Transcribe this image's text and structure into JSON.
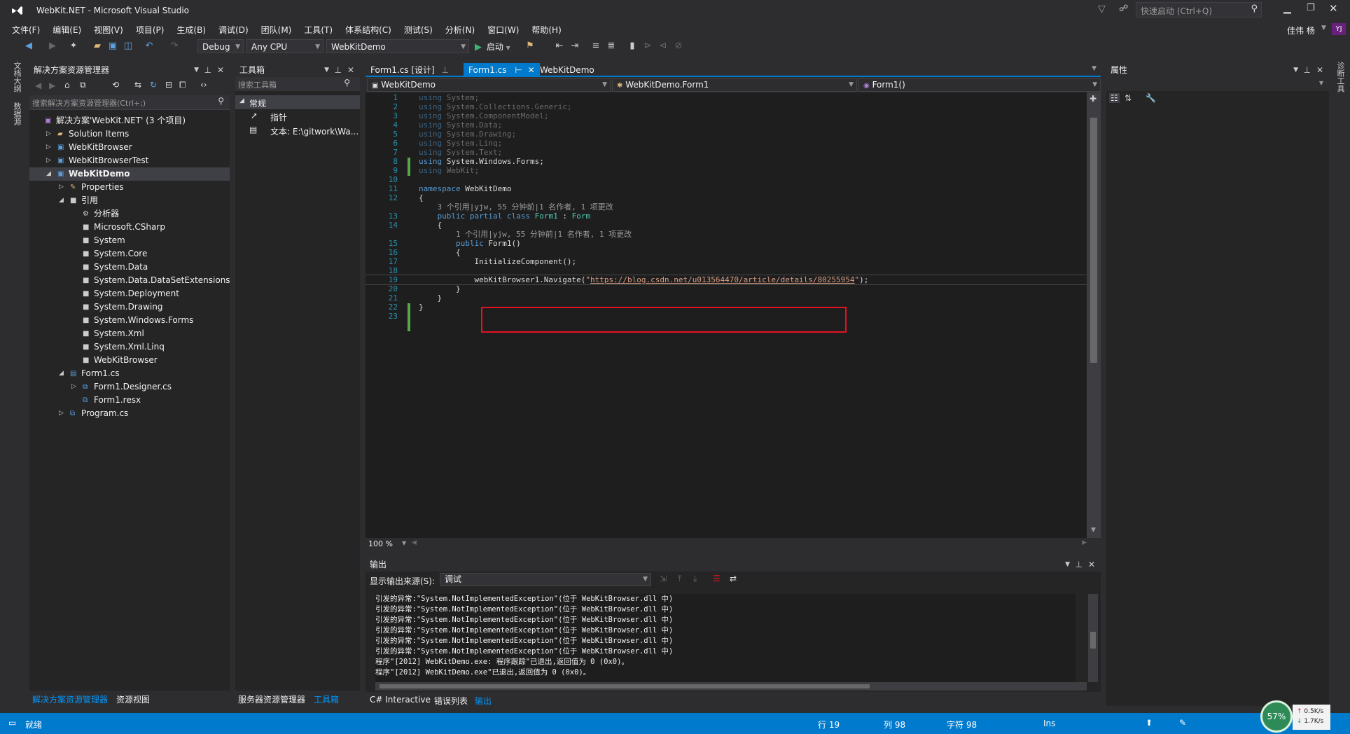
{
  "window": {
    "title": "WebKit.NET - Microsoft Visual Studio",
    "quick_launch": "快速启动 (Ctrl+Q)",
    "user": "佳伟 杨",
    "user_badge": "YJ"
  },
  "menu": [
    "文件(F)",
    "编辑(E)",
    "视图(V)",
    "项目(P)",
    "生成(B)",
    "调试(D)",
    "团队(M)",
    "工具(T)",
    "体系结构(C)",
    "测试(S)",
    "分析(N)",
    "窗口(W)",
    "帮助(H)"
  ],
  "toolbar": {
    "config": "Debug",
    "platform": "Any CPU",
    "project": "WebKitDemo",
    "start_label": "启动"
  },
  "left_strip": [
    "文档大纲",
    "数据源"
  ],
  "right_strip": [
    "诊断工具"
  ],
  "solution_explorer": {
    "title": "解决方案资源管理器",
    "search_placeholder": "搜索解决方案资源管理器(Ctrl+;)",
    "items": [
      {
        "label": "解决方案'WebKit.NET' (3 个项目)",
        "level": 0,
        "expander": "",
        "icon": "solution-icon",
        "bold": false,
        "selected": false
      },
      {
        "label": "Solution Items",
        "level": 1,
        "expander": "▷",
        "icon": "folder-icon",
        "bold": false,
        "selected": false
      },
      {
        "label": "WebKitBrowser",
        "level": 1,
        "expander": "▷",
        "icon": "csproj-icon",
        "bold": false,
        "selected": false
      },
      {
        "label": "WebKitBrowserTest",
        "level": 1,
        "expander": "▷",
        "icon": "csproj-icon",
        "bold": false,
        "selected": false
      },
      {
        "label": "WebKitDemo",
        "level": 1,
        "expander": "◢",
        "icon": "csproj-icon",
        "bold": true,
        "selected": true
      },
      {
        "label": "Properties",
        "level": 2,
        "expander": "▷",
        "icon": "wrench-icon",
        "bold": false,
        "selected": false
      },
      {
        "label": "引用",
        "level": 2,
        "expander": "◢",
        "icon": "references-icon",
        "bold": false,
        "selected": false
      },
      {
        "label": "分析器",
        "level": 3,
        "expander": "",
        "icon": "analyzer-icon",
        "bold": false,
        "selected": false
      },
      {
        "label": "Microsoft.CSharp",
        "level": 3,
        "expander": "",
        "icon": "reference-icon",
        "bold": false,
        "selected": false
      },
      {
        "label": "System",
        "level": 3,
        "expander": "",
        "icon": "reference-icon",
        "bold": false,
        "selected": false
      },
      {
        "label": "System.Core",
        "level": 3,
        "expander": "",
        "icon": "reference-icon",
        "bold": false,
        "selected": false
      },
      {
        "label": "System.Data",
        "level": 3,
        "expander": "",
        "icon": "reference-icon",
        "bold": false,
        "selected": false
      },
      {
        "label": "System.Data.DataSetExtensions",
        "level": 3,
        "expander": "",
        "icon": "reference-icon",
        "bold": false,
        "selected": false
      },
      {
        "label": "System.Deployment",
        "level": 3,
        "expander": "",
        "icon": "reference-icon",
        "bold": false,
        "selected": false
      },
      {
        "label": "System.Drawing",
        "level": 3,
        "expander": "",
        "icon": "reference-icon",
        "bold": false,
        "selected": false
      },
      {
        "label": "System.Windows.Forms",
        "level": 3,
        "expander": "",
        "icon": "reference-icon",
        "bold": false,
        "selected": false
      },
      {
        "label": "System.Xml",
        "level": 3,
        "expander": "",
        "icon": "reference-icon",
        "bold": false,
        "selected": false
      },
      {
        "label": "System.Xml.Linq",
        "level": 3,
        "expander": "",
        "icon": "reference-icon",
        "bold": false,
        "selected": false
      },
      {
        "label": "WebKitBrowser",
        "level": 3,
        "expander": "",
        "icon": "reference-icon",
        "bold": false,
        "selected": false
      },
      {
        "label": "Form1.cs",
        "level": 2,
        "expander": "◢",
        "icon": "form-icon",
        "bold": false,
        "selected": false
      },
      {
        "label": "Form1.Designer.cs",
        "level": 3,
        "expander": "▷",
        "icon": "cs-file-icon",
        "bold": false,
        "selected": false
      },
      {
        "label": "Form1.resx",
        "level": 3,
        "expander": "",
        "icon": "resx-icon",
        "bold": false,
        "selected": false
      },
      {
        "label": "Program.cs",
        "level": 2,
        "expander": "▷",
        "icon": "cs-file-icon",
        "bold": false,
        "selected": false
      }
    ],
    "bottom_tabs": [
      "解决方案资源管理器",
      "资源视图"
    ]
  },
  "toolbox": {
    "title": "工具箱",
    "search_placeholder": "搜索工具箱",
    "group": "常规",
    "items": [
      "指针",
      "文本: E:\\gitwork\\Wa..."
    ],
    "bottom_tabs": [
      "服务器资源管理器",
      "工具箱"
    ]
  },
  "editor": {
    "tabs": [
      {
        "label": "Form1.cs [设计]",
        "active": false
      },
      {
        "label": "Form1.cs",
        "active": true
      },
      {
        "label": "WebKitDemo",
        "active": false
      }
    ],
    "nav": {
      "project": "WebKitDemo",
      "type": "WebKitDemo.Form1",
      "member": "Form1()"
    },
    "zoom": "100 %",
    "lines": [
      {
        "n": "1",
        "text": "using System;",
        "kind": "using-dim"
      },
      {
        "n": "2",
        "text": "using System.Collections.Generic;",
        "kind": "using-dim"
      },
      {
        "n": "3",
        "text": "using System.ComponentModel;",
        "kind": "using-dim"
      },
      {
        "n": "4",
        "text": "using System.Data;",
        "kind": "using-dim"
      },
      {
        "n": "5",
        "text": "using System.Drawing;",
        "kind": "using-dim"
      },
      {
        "n": "6",
        "text": "using System.Linq;",
        "kind": "using-dim"
      },
      {
        "n": "7",
        "text": "using System.Text;",
        "kind": "using-dim"
      },
      {
        "n": "8",
        "text": "using System.Windows.Forms;",
        "kind": "using"
      },
      {
        "n": "9",
        "text": "using WebKit;",
        "kind": "using-dim"
      },
      {
        "n": "10",
        "text": "",
        "kind": "plain"
      },
      {
        "n": "11",
        "text": "namespace WebKitDemo",
        "kind": "namespace"
      },
      {
        "n": "12",
        "text": "{",
        "kind": "plain"
      },
      {
        "n": "",
        "text": "    3 个引用|yjw, 55 分钟前|1 名作者, 1 项更改",
        "kind": "lens"
      },
      {
        "n": "13",
        "text": "    public partial class Form1 : Form",
        "kind": "class"
      },
      {
        "n": "14",
        "text": "    {",
        "kind": "plain"
      },
      {
        "n": "",
        "text": "        1 个引用|yjw, 55 分钟前|1 名作者, 1 项更改",
        "kind": "lens"
      },
      {
        "n": "15",
        "text": "        public Form1()",
        "kind": "ctor"
      },
      {
        "n": "16",
        "text": "        {",
        "kind": "plain"
      },
      {
        "n": "17",
        "text": "            InitializeComponent();",
        "kind": "plain"
      },
      {
        "n": "18",
        "text": "",
        "kind": "plain"
      },
      {
        "n": "19",
        "text": "            webKitBrowser1.Navigate(\"https://blog.csdn.net/u013564470/article/details/80255954\");",
        "kind": "navigate"
      },
      {
        "n": "20",
        "text": "        }",
        "kind": "plain"
      },
      {
        "n": "21",
        "text": "    }",
        "kind": "plain"
      },
      {
        "n": "22",
        "text": "}",
        "kind": "plain"
      },
      {
        "n": "23",
        "text": "",
        "kind": "plain"
      }
    ],
    "navigate_url": "https://blog.csdn.net/u013564470/article/details/80255954"
  },
  "output": {
    "title": "输出",
    "source_label": "显示输出来源(S):",
    "source_value": "调试",
    "lines": [
      "引发的异常:\"System.NotImplementedException\"(位于 WebKitBrowser.dll 中)",
      "引发的异常:\"System.NotImplementedException\"(位于 WebKitBrowser.dll 中)",
      "引发的异常:\"System.NotImplementedException\"(位于 WebKitBrowser.dll 中)",
      "引发的异常:\"System.NotImplementedException\"(位于 WebKitBrowser.dll 中)",
      "引发的异常:\"System.NotImplementedException\"(位于 WebKitBrowser.dll 中)",
      "引发的异常:\"System.NotImplementedException\"(位于 WebKitBrowser.dll 中)",
      "程序\"[2012] WebKitDemo.exe: 程序跟踪\"已退出,返回值为 0 (0x0)。",
      "程序\"[2012] WebKitDemo.exe\"已退出,返回值为 0 (0x0)。"
    ],
    "bottom_tabs": [
      "C# Interactive",
      "错误列表",
      "输出"
    ]
  },
  "properties": {
    "title": "属性"
  },
  "status": {
    "ready": "就绪",
    "line": "行 19",
    "col": "列 98",
    "ch": "字符 98",
    "ins": "Ins",
    "net_percent": "57%",
    "up": "0.5K/s",
    "down": "1.7K/s"
  },
  "colors": {
    "accent": "#007acc",
    "highlight_box": "#e81123",
    "selected": "#3f3f46"
  }
}
